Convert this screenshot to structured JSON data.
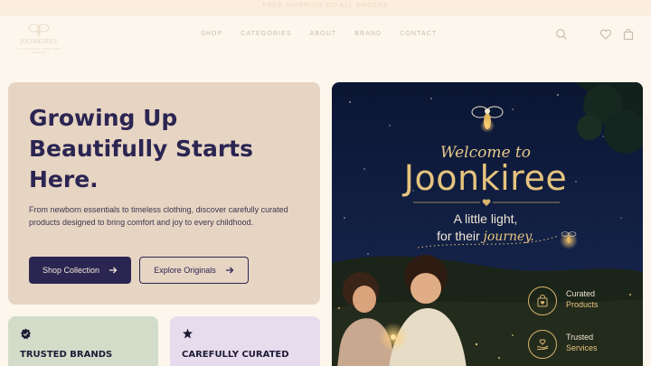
{
  "announcement": "FREE SHIPPING ON ALL ORDERS",
  "brand": {
    "logo_word": "JOONKIREE",
    "logo_sub": "A LITTLE LIGHT FOR THEIR JOURNEY"
  },
  "nav": {
    "items": [
      "SHOP",
      "CATEGORIES",
      "ABOUT",
      "BRAND",
      "CONTACT"
    ]
  },
  "header_icons": [
    "search-icon",
    "heart-icon",
    "bag-icon"
  ],
  "hero": {
    "title_line1": "Growing Up",
    "title_line2": "Beautifully Starts",
    "title_line3": "Here.",
    "description": "From newborn essentials to timeless clothing, discover carefully curated products designed to bring comfort and joy to every childhood.",
    "primary_button": "Shop Collection",
    "secondary_button": "Explore Originals"
  },
  "banner": {
    "welcome": "Welcome to",
    "brand_name": "Joonkiree",
    "tagline_line1": "A little light,",
    "tagline_line2_prefix": "for their",
    "tagline_line2_highlight": "journey.",
    "features": [
      {
        "line1": "Curated",
        "line2": "Products",
        "icon": "shopping-bag-icon"
      },
      {
        "line1": "Trusted",
        "line2": "Services",
        "icon": "heart-hand-icon"
      }
    ]
  },
  "cards": [
    {
      "title": "TRUSTED BRANDS",
      "icon": "badge-check-icon",
      "color": "#d3dcc9"
    },
    {
      "title": "CAREFULLY CURATED",
      "icon": "sparkle-icon",
      "color": "#e6dcee"
    }
  ],
  "colors": {
    "primary": "#2b2552",
    "background": "#fdf6ec",
    "hero_panel": "#e7d5c3",
    "gold": "#e6c47e",
    "night": "#0f1a3a"
  }
}
